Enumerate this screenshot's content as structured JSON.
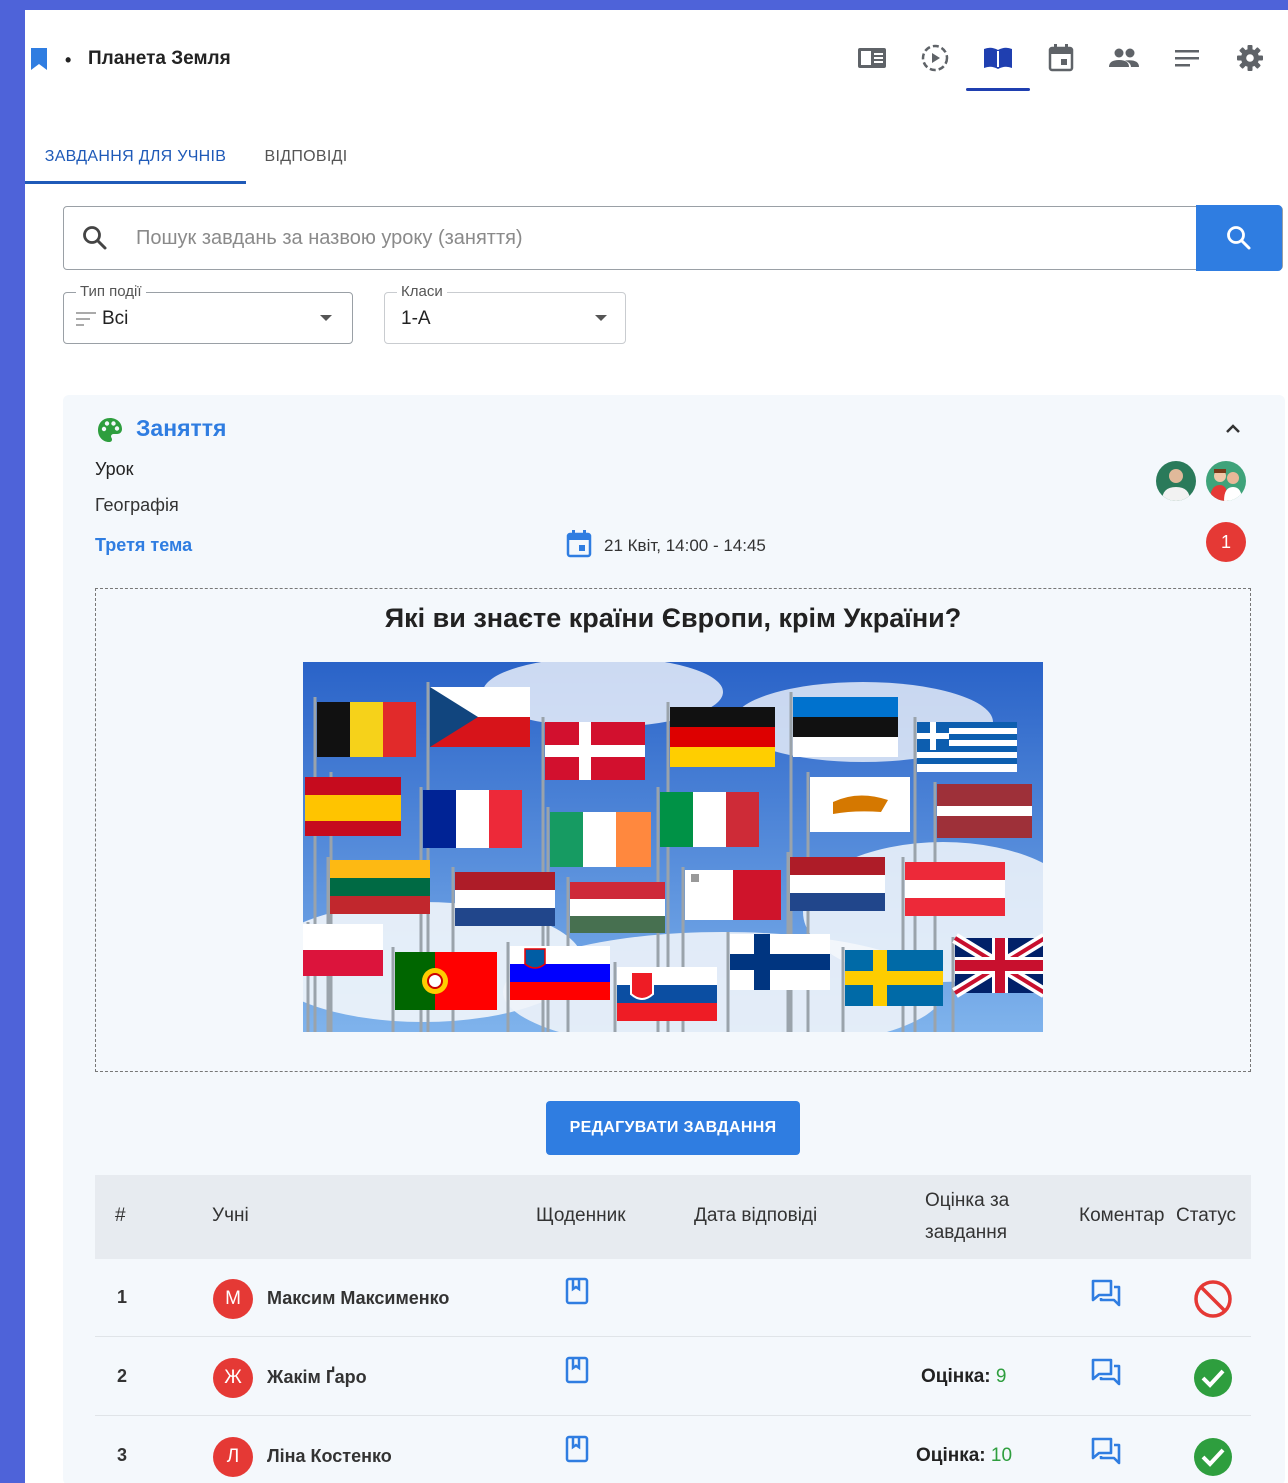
{
  "header": {
    "dot": "•",
    "course_title": "Планета Земля",
    "toolbar": [
      "board-icon",
      "play-circle-icon",
      "book-icon",
      "calendar-icon",
      "people-icon",
      "list-icon",
      "gear-icon"
    ]
  },
  "tabs": [
    {
      "label": "ЗАВДАННЯ ДЛЯ УЧНІВ",
      "active": true
    },
    {
      "label": "ВІДПОВІДІ",
      "active": false
    }
  ],
  "search": {
    "placeholder": "Пошук завдань за назвою уроку (заняття)"
  },
  "filters": {
    "event_type": {
      "label": "Тип події",
      "value": "Всі"
    },
    "classes": {
      "label": "Класи",
      "value": "1-А"
    }
  },
  "card": {
    "event_type": "Заняття",
    "event_kind": "Урок",
    "subject": "Географія",
    "topic": "Третя тема",
    "date": "21 Квіт, 14:00 - 14:45",
    "badge_count": "1",
    "question": "Які ви знаєте країни Європи, крім України?",
    "edit_button": "РЕДАГУВАТИ ЗАВДАННЯ",
    "colors": {
      "accent": "#2f7de1",
      "success": "#2e9e3e",
      "danger": "#e53935"
    }
  },
  "table": {
    "headers": {
      "num": "#",
      "students": "Учні",
      "diary": "Щоденник",
      "answer_date": "Дата відповіді",
      "grade_line1": "Оцінка за",
      "grade_line2": "завдання",
      "comment": "Коментар",
      "status": "Статус"
    },
    "grade_label": "Оцінка:",
    "rows": [
      {
        "num": "1",
        "initial": "М",
        "name": "Максим Максименко",
        "grade": "",
        "status": "rejected"
      },
      {
        "num": "2",
        "initial": "Ж",
        "name": "Жакім Ґаро",
        "grade": "9",
        "status": "done"
      },
      {
        "num": "3",
        "initial": "Л",
        "name": "Ліна Костенко",
        "grade": "10",
        "status": "done"
      }
    ]
  }
}
